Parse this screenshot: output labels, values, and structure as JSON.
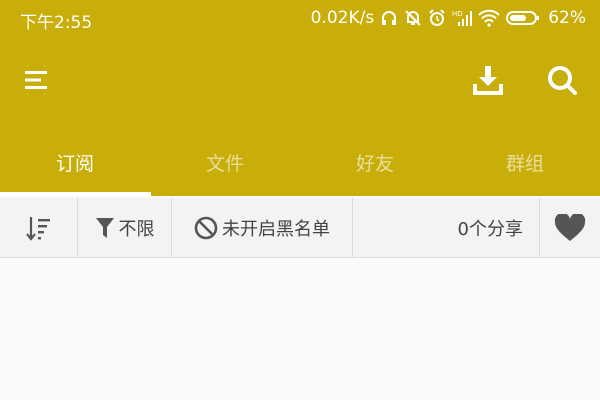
{
  "status_bar": {
    "time": "下午2:55",
    "network_speed": "0.02K/s",
    "battery_percent": "62%",
    "icons": [
      "headphones-icon",
      "alarm-off-icon",
      "alarm-clock-icon",
      "hd-signal-icon",
      "wifi-icon",
      "battery-icon"
    ]
  },
  "toolbar": {
    "menu_icon": "menu-icon",
    "download_icon": "download-icon",
    "search_icon": "search-icon"
  },
  "tabs": [
    {
      "label": "订阅",
      "active": true
    },
    {
      "label": "文件",
      "active": false
    },
    {
      "label": "好友",
      "active": false
    },
    {
      "label": "群组",
      "active": false
    }
  ],
  "filter_bar": {
    "sort_icon": "sort-icon",
    "filter_label": "不限",
    "blacklist_label": "未开启黑名单",
    "share_count": "0个分享",
    "favorite_icon": "heart-icon"
  },
  "colors": {
    "header": "#c9ad09",
    "tab_inactive": "rgba(255,255,255,0.6)",
    "filter_bar_bg": "#f3f3f3"
  }
}
